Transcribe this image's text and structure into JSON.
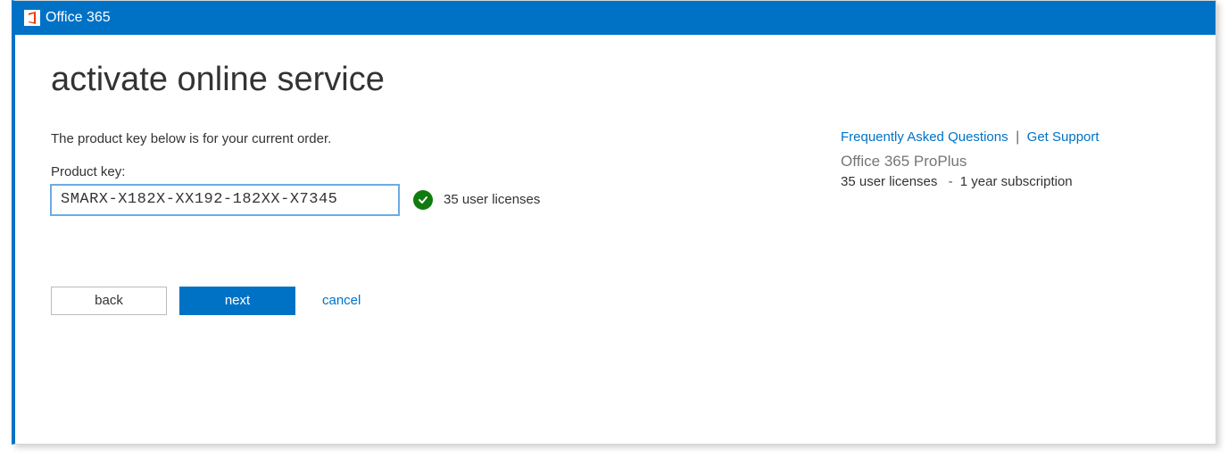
{
  "header": {
    "brand": "Office 365"
  },
  "main": {
    "title": "activate online service",
    "intro": "The product key below is for your current order.",
    "product_key_label": "Product key:",
    "product_key_value": "SMARX-X182X-XX192-182XX-X7345",
    "license_status": "35 user licenses",
    "buttons": {
      "back": "back",
      "next": "next",
      "cancel": "cancel"
    }
  },
  "sidebar": {
    "faq_link": "Frequently Asked Questions",
    "support_link": "Get Support",
    "separator": "|",
    "product_name": "Office 365 ProPlus",
    "licenses_line": "35 user licenses",
    "term_line": "1 year subscription",
    "dash": "-"
  }
}
